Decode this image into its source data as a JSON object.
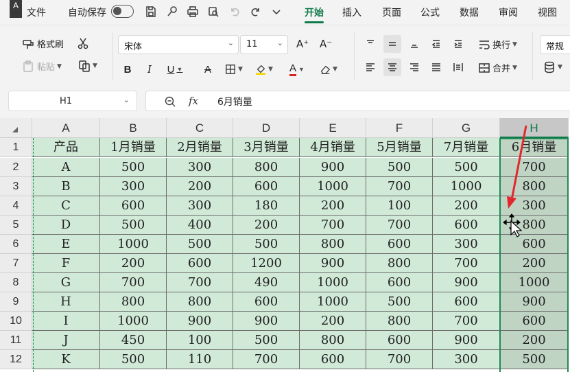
{
  "app": {
    "logo_letter": "A"
  },
  "menubar": {
    "file": "文件",
    "autosave": "自动保存",
    "tabs": [
      {
        "label": "开始",
        "active": true
      },
      {
        "label": "插入",
        "active": false
      },
      {
        "label": "页面",
        "active": false
      },
      {
        "label": "公式",
        "active": false
      },
      {
        "label": "数据",
        "active": false
      },
      {
        "label": "审阅",
        "active": false
      },
      {
        "label": "视图",
        "active": false
      }
    ]
  },
  "ribbon": {
    "format_painter": "格式刷",
    "paste": "粘贴",
    "font_name": "宋体",
    "font_size": "11",
    "wrap": "换行",
    "merge": "合并",
    "number_format": "常规"
  },
  "formula_bar": {
    "name_box": "H1",
    "fx": "fx",
    "content": "6月销量"
  },
  "grid": {
    "columns": [
      "A",
      "B",
      "C",
      "D",
      "E",
      "F",
      "G",
      "H"
    ],
    "selected_column": "H",
    "row_numbers": [
      "1",
      "2",
      "3",
      "4",
      "5",
      "6",
      "7",
      "8",
      "9",
      "10",
      "11",
      "12"
    ],
    "rows": [
      [
        "产品",
        "1月销量",
        "2月销量",
        "3月销量",
        "4月销量",
        "5月销量",
        "7月销量",
        "6月销量"
      ],
      [
        "A",
        "500",
        "300",
        "800",
        "900",
        "500",
        "500",
        "700"
      ],
      [
        "B",
        "300",
        "200",
        "600",
        "1000",
        "700",
        "1000",
        "800"
      ],
      [
        "C",
        "600",
        "300",
        "180",
        "200",
        "100",
        "200",
        "300"
      ],
      [
        "D",
        "500",
        "400",
        "200",
        "700",
        "700",
        "600",
        "800"
      ],
      [
        "E",
        "1000",
        "500",
        "500",
        "800",
        "600",
        "300",
        "600"
      ],
      [
        "F",
        "200",
        "600",
        "1200",
        "900",
        "800",
        "700",
        "200"
      ],
      [
        "G",
        "700",
        "700",
        "490",
        "1000",
        "600",
        "900",
        "1000"
      ],
      [
        "H",
        "800",
        "800",
        "600",
        "1000",
        "500",
        "600",
        "900"
      ],
      [
        "I",
        "1000",
        "900",
        "900",
        "200",
        "800",
        "700",
        "600"
      ],
      [
        "J",
        "450",
        "100",
        "500",
        "800",
        "600",
        "900",
        "200"
      ],
      [
        "K",
        "500",
        "110",
        "700",
        "600",
        "700",
        "300",
        "500"
      ]
    ]
  },
  "colors": {
    "accent": "#0f7b4b",
    "cell_fill": "#d1ead7",
    "annotation_arrow": "#e0282e"
  }
}
